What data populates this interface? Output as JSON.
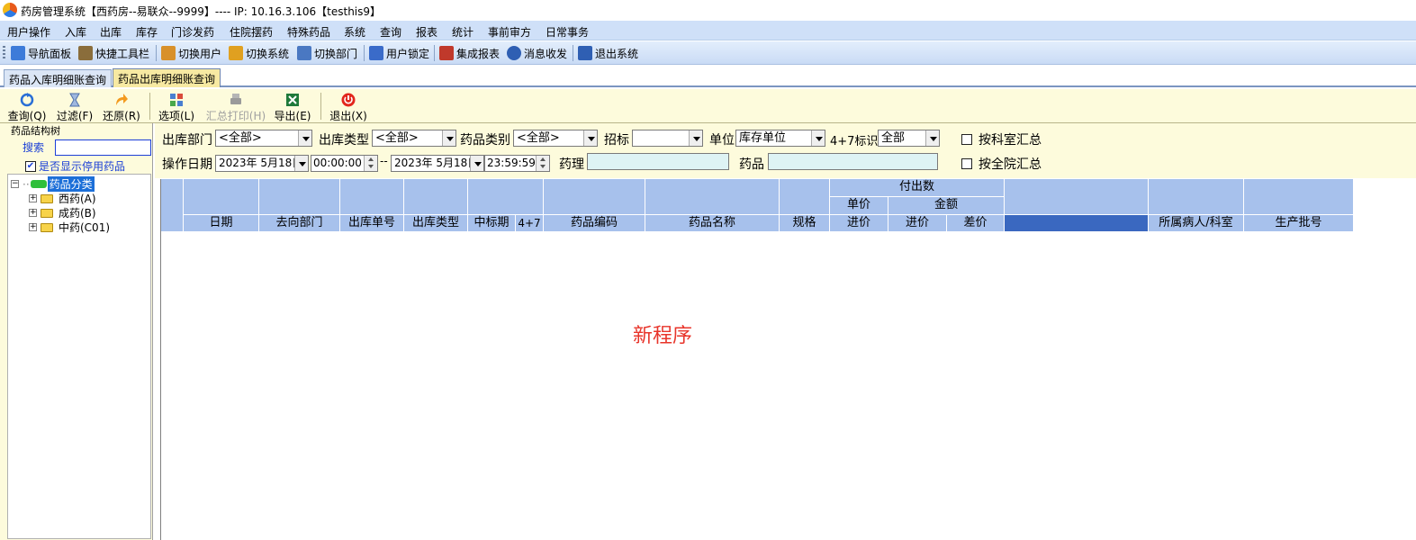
{
  "window": {
    "title": "药房管理系统【西药房--易联众--9999】---- IP: 10.16.3.106【testhis9】"
  },
  "menubar": {
    "items": [
      "用户操作",
      "入库",
      "出库",
      "库存",
      "门诊发药",
      "住院摆药",
      "特殊药品",
      "系统",
      "查询",
      "报表",
      "统计",
      "事前审方",
      "日常事务"
    ]
  },
  "toolbar": {
    "items": [
      {
        "label": "导航面板",
        "icon": "navigation-panel-icon",
        "color": "#3d7bd9"
      },
      {
        "label": "快捷工具栏",
        "icon": "quick-toolbar-icon",
        "color": "#8a6d3b"
      },
      {
        "label": "切换用户",
        "icon": "switch-user-icon",
        "color": "#d8902a"
      },
      {
        "label": "切换系统",
        "icon": "switch-system-icon",
        "color": "#e0a020"
      },
      {
        "label": "切换部门",
        "icon": "switch-department-icon",
        "color": "#4a78c2"
      },
      {
        "label": "用户锁定",
        "icon": "user-lock-icon",
        "color": "#3a6bc9"
      },
      {
        "label": "集成报表",
        "icon": "integrated-report-icon",
        "color": "#c0392b"
      },
      {
        "label": "消息收发",
        "icon": "message-icon",
        "color": "#2f5fb3"
      },
      {
        "label": "退出系统",
        "icon": "exit-system-icon",
        "color": "#2f5fb3"
      }
    ]
  },
  "tabs": [
    {
      "label": "药品入库明细账查询",
      "active": false
    },
    {
      "label": "药品出库明细账查询",
      "active": true
    }
  ],
  "actions": {
    "query": "查询(Q)",
    "filter": "过滤(F)",
    "restore": "还原(R)",
    "options": "选项(L)",
    "summary_print": "汇总打印(H)",
    "export": "导出(E)",
    "exit": "退出(X)"
  },
  "tree_panel": {
    "group_title": "药品结构树",
    "search_label": "搜索",
    "search_value": "",
    "show_disabled_label": "是否显示停用药品",
    "show_disabled_checked": true,
    "root": "药品分类",
    "nodes": [
      "西药(A)",
      "成药(B)",
      "中药(C01)"
    ]
  },
  "filters": {
    "out_dept_label": "出库部门",
    "out_dept_value": "<全部>",
    "out_type_label": "出库类型",
    "out_type_value": "<全部>",
    "drug_category_label": "药品类别",
    "drug_category_value": "<全部>",
    "bid_label": "招标",
    "bid_value": "",
    "unit_label": "单位",
    "unit_value": "库存单位",
    "flag47_label": "4+7标识",
    "flag47_value": "全部",
    "by_dept_summary": "按科室汇总",
    "by_dept_checked": false,
    "op_date_label": "操作日期",
    "date_from": "2023年 5月18日",
    "time_from": "00:00:00",
    "range_sep": "--",
    "date_to": "2023年 5月18日",
    "time_to": "23:59:59",
    "pharmacology_label": "药理",
    "pharmacology_value": "",
    "drug_label": "药品",
    "drug_value": "",
    "by_hospital_summary": "按全院汇总",
    "by_hospital_checked": false
  },
  "grid": {
    "group_header": "付出数",
    "sub_unit_price": "单价",
    "sub_amount": "金额",
    "columns": {
      "date": "日期",
      "to_dept": "去向部门",
      "out_no": "出库单号",
      "out_type": "出库类型",
      "bid_period": "中标期",
      "flag47": "4+7",
      "drug_code": "药品编码",
      "drug_name": "药品名称",
      "spec": "规格",
      "unit_purchase": "进价",
      "amount_purchase": "进价",
      "price_diff": "差价",
      "patient_dept": "所属病人/科室",
      "batch_no": "生产批号"
    }
  },
  "watermark": "新程序",
  "colors": {
    "menubar_bg": "#cfe0f8",
    "panel_bg": "#fdfbdc",
    "grid_header_bg": "#a7c1ec",
    "selected_header_bg": "#3a68c0",
    "watermark": "#e8342a",
    "link_blue": "#1a3fd6"
  }
}
